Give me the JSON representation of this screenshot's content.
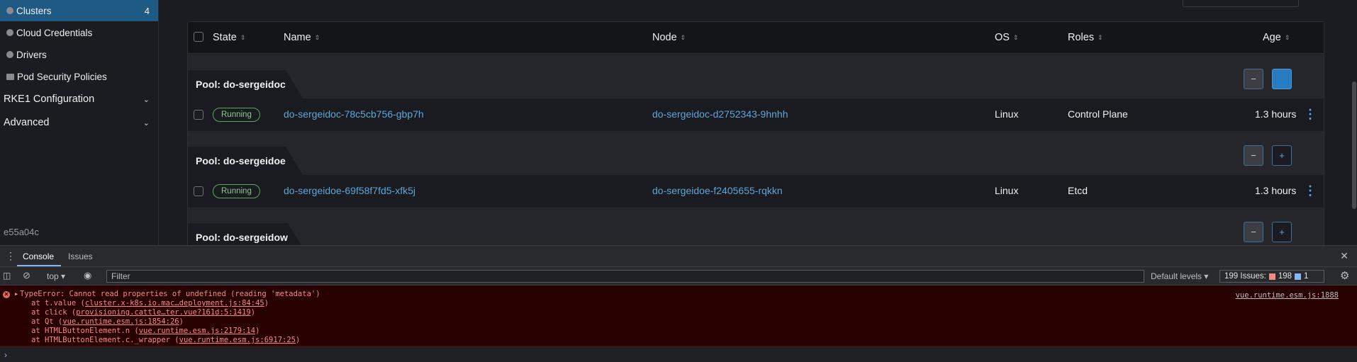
{
  "sidebar": {
    "items": [
      {
        "label": "Clusters",
        "count": "4"
      },
      {
        "label": "Cloud Credentials"
      },
      {
        "label": "Drivers"
      },
      {
        "label": "Pod Security Policies"
      }
    ],
    "groups": [
      {
        "label": "RKE1 Configuration"
      },
      {
        "label": "Advanced"
      }
    ],
    "version": "e55a04c"
  },
  "table": {
    "headers": {
      "state": "State",
      "name": "Name",
      "node": "Node",
      "os": "OS",
      "roles": "Roles",
      "age": "Age"
    },
    "pools": [
      {
        "label": "Pool: do-sergeidoc",
        "rows": [
          {
            "state": "Running",
            "name": "do-sergeidoc-78c5cb756-gbp7h",
            "node": "do-sergeidoc-d2752343-9hnhh",
            "os": "Linux",
            "roles": "Control Plane",
            "age": "1.3 hours"
          }
        ]
      },
      {
        "label": "Pool: do-sergeidoe",
        "rows": [
          {
            "state": "Running",
            "name": "do-sergeidoe-69f58f7fd5-xfk5j",
            "node": "do-sergeidoe-f2405655-rqkkn",
            "os": "Linux",
            "roles": "Etcd",
            "age": "1.3 hours"
          }
        ]
      },
      {
        "label": "Pool: do-sergeidow",
        "rows": []
      }
    ],
    "minus": "−",
    "plus": "+"
  },
  "devtools": {
    "tabs": [
      "Console",
      "Issues"
    ],
    "context": "top",
    "filter_placeholder": "Filter",
    "levels": "Default levels",
    "issues_label": "199 Issues:",
    "issues_errors": "198",
    "issues_info": "1",
    "error": {
      "message": "TypeError: Cannot read properties of undefined (reading 'metadata')",
      "source": "vue.runtime.esm.js:1888",
      "stack": [
        {
          "prefix": "at t.value (",
          "link": "cluster.x-k8s.io.mac…deployment.js:84:45",
          "suffix": ")"
        },
        {
          "prefix": "at click (",
          "link": "provisioning.cattle…ter.vue?161d:5:1419",
          "suffix": ")"
        },
        {
          "prefix": "at Qt (",
          "link": "vue.runtime.esm.js:1854:26",
          "suffix": ")"
        },
        {
          "prefix": "at HTMLButtonElement.n (",
          "link": "vue.runtime.esm.js:2179:14",
          "suffix": ")"
        },
        {
          "prefix": "at HTMLButtonElement.c._wrapper (",
          "link": "vue.runtime.esm.js:6917:25",
          "suffix": ")"
        }
      ]
    }
  }
}
